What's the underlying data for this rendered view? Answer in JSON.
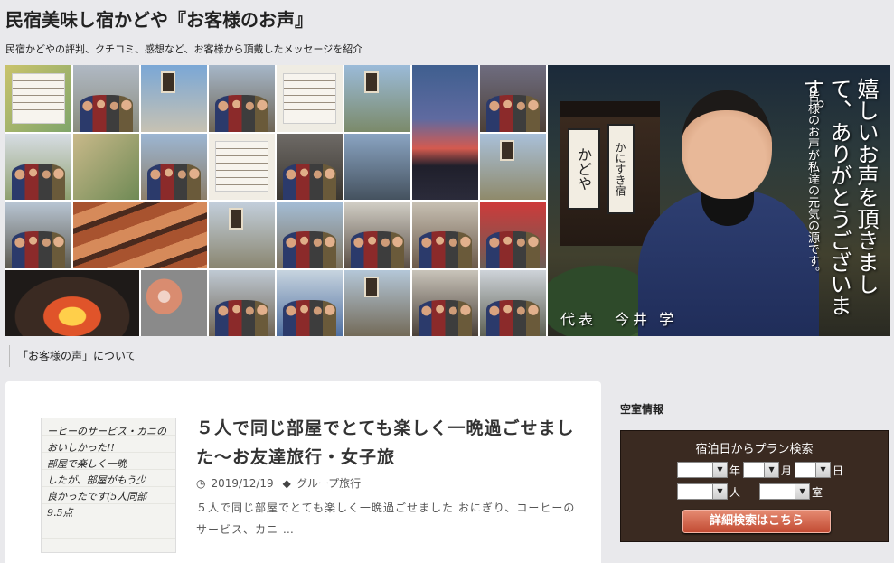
{
  "site": {
    "title": "民宿美味し宿かどや『お客様のお声』",
    "description": "民宿かどやの評判、クチコミ、感想など、お客様から頂戴したメッセージを紹介"
  },
  "banner": {
    "quote": "嬉しいお声を頂きまして、ありがとうございます。",
    "subquote": "皆様のお声が私達の元気の源です。",
    "signature": "代表　今井 学",
    "sign_main": "かどや",
    "sign_side": "かにすき宿"
  },
  "page_link": {
    "label": "「お客様の声」について"
  },
  "post": {
    "title": "５人で同じ部屋でとても楽しく一晩過ごせました〜お友達旅行・女子旅",
    "date": "2019/12/19",
    "category": "グループ旅行",
    "excerpt": "５人で同じ部屋でとても楽しく一晩過ごせました おにぎり、コーヒーのサービス、カニ …",
    "thumb_text": "ーヒーのサービス・カニの\nおいしかった!!\n部屋で楽しく一晩\nしたが、部屋がもう少\n良かったです(5人同部\n9.5点"
  },
  "sidebar": {
    "heading": "空室情報",
    "widget": {
      "title": "宿泊日からプラン検索",
      "unit_year": "年",
      "unit_month": "月",
      "unit_day": "日",
      "unit_people": "人",
      "unit_rooms": "室",
      "button_label": "詳細検索はこちら"
    }
  },
  "icons": {
    "clock": "clock-icon",
    "tags": "tags-icon",
    "dropdown": "chevron-down-icon"
  }
}
